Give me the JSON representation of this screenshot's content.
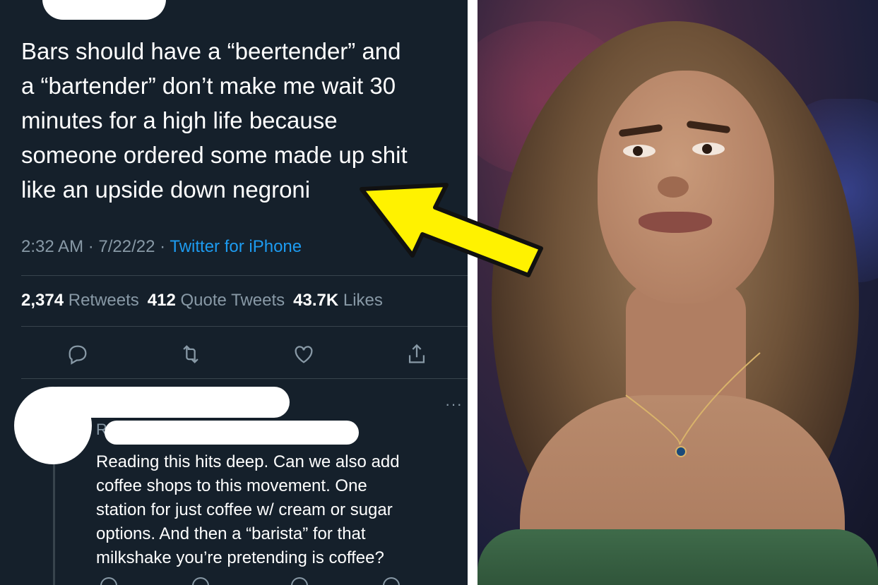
{
  "tweet": {
    "text": "Bars should have a “beertender” and\na “bartender” don’t make me wait 30\nminutes for a high life because\nsomeone ordered some made up shit\nlike an upside down negroni",
    "time": "2:32 AM · 7/22/22 · ",
    "source": "Twitter for iPhone",
    "retweets_count": "2,374",
    "retweets_label": "Retweets",
    "quotes_count": "412",
    "quotes_label": "Quote Tweets",
    "likes_count": "43.7K",
    "likes_label": "Likes"
  },
  "reply": {
    "handle_initial": "R",
    "more": "···",
    "text": "Reading this hits deep. Can we also add\ncoffee shops to this movement. One\nstation for just coffee w/ cream or sugar\noptions. And then a “barista” for that\nmilkshake you’re pretending is coffee?"
  },
  "icons": {
    "reply": "reply-icon",
    "retweet": "retweet-icon",
    "like": "heart-icon",
    "share": "share-icon",
    "arrow": "arrow-annotation-icon"
  },
  "colors": {
    "background": "#15202b",
    "text": "#ffffff",
    "muted": "#8899a6",
    "link": "#1d9bf0",
    "arrow": "#fff200"
  }
}
